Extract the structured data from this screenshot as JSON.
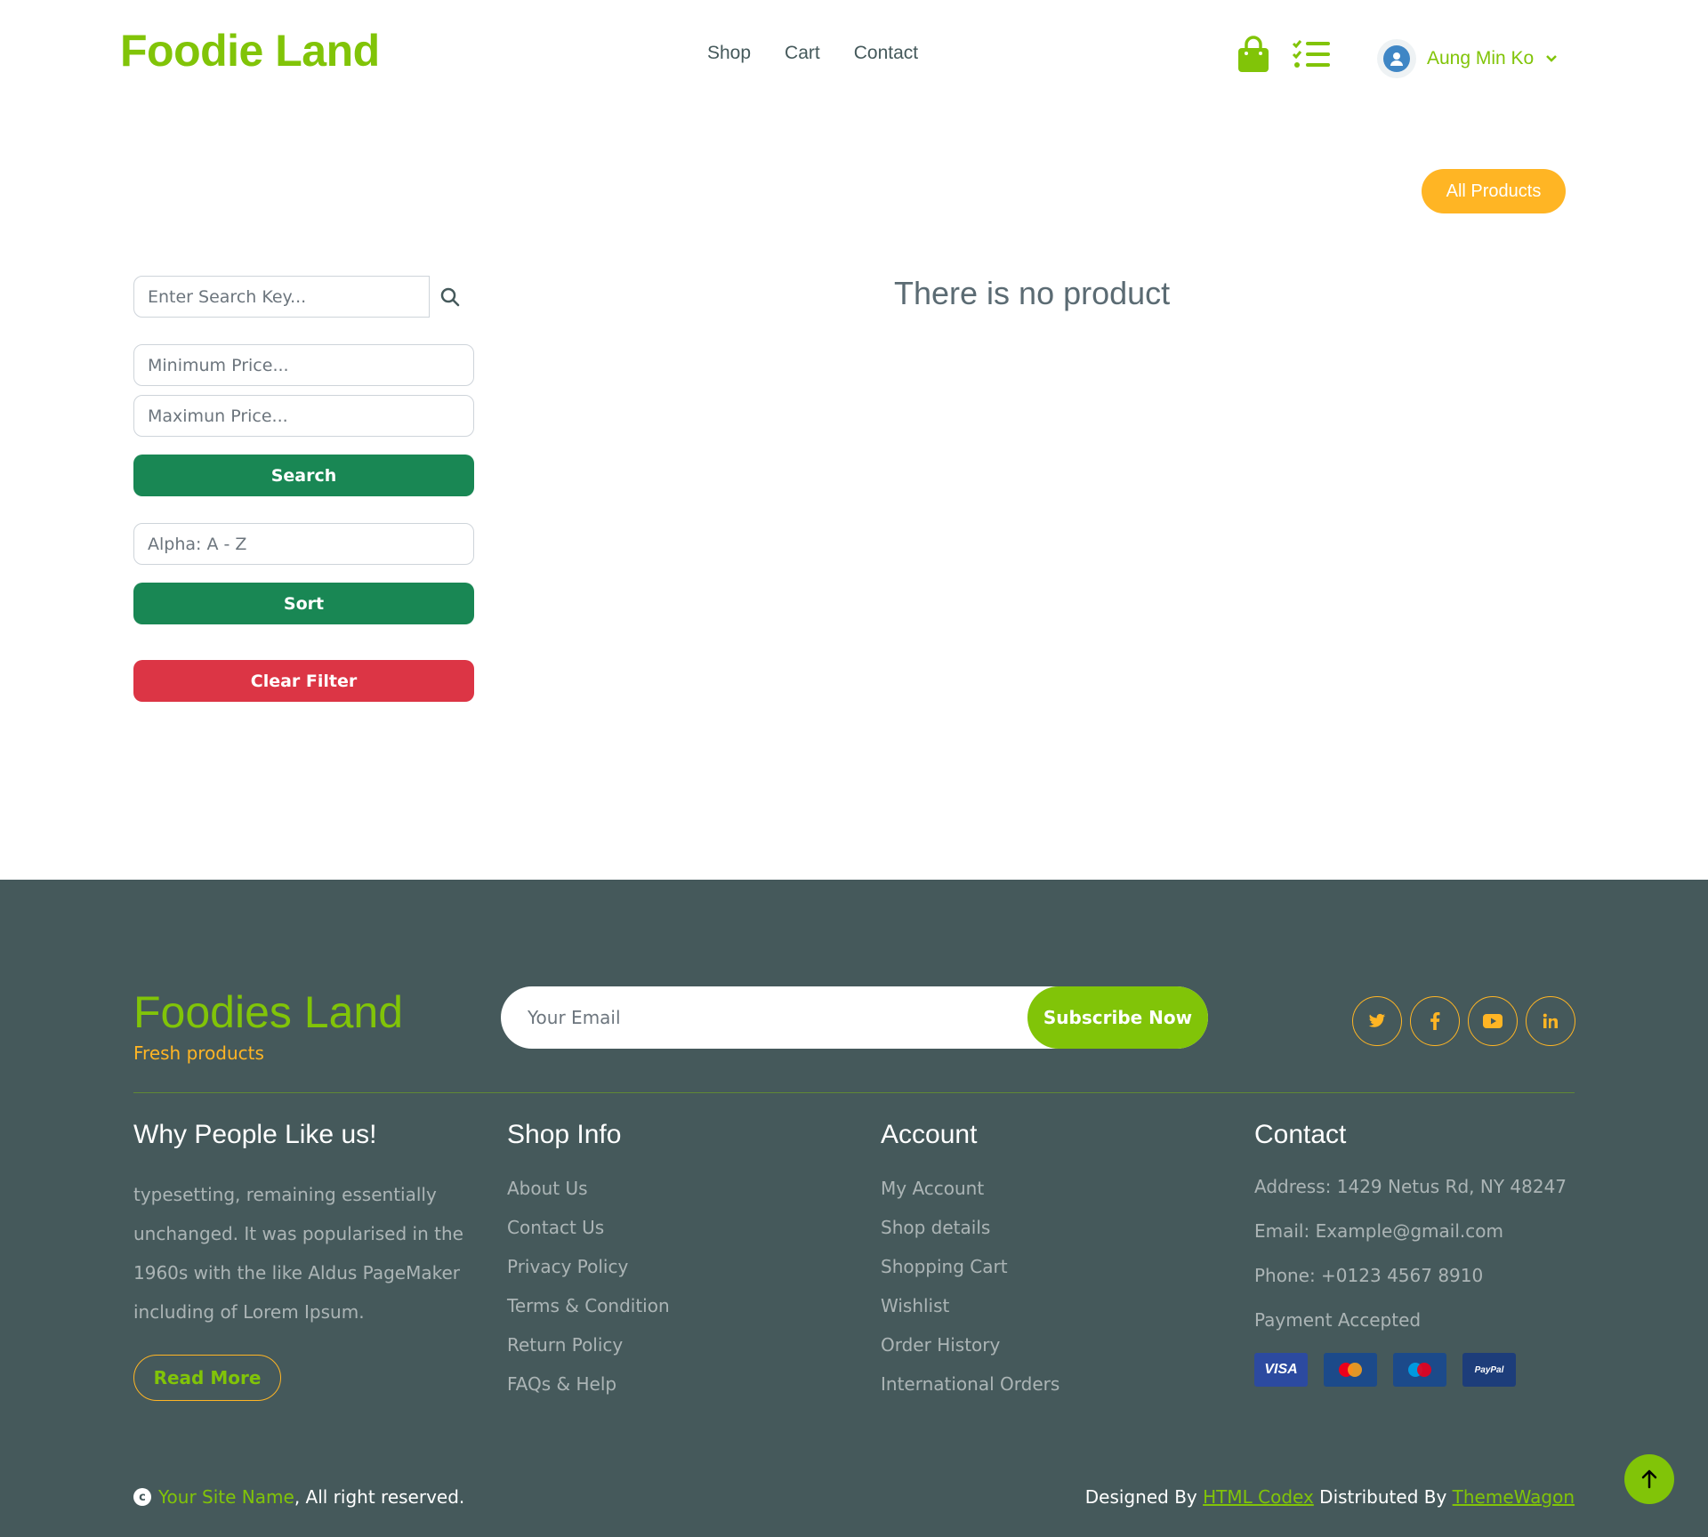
{
  "header": {
    "brand": "Foodie Land",
    "nav": [
      "Shop",
      "Cart",
      "Contact"
    ],
    "user_name": "Aung Min Ko",
    "icons": [
      "shopping-bag-icon",
      "checklist-icon",
      "user-icon",
      "chevron-down-icon"
    ]
  },
  "main": {
    "all_products_label": "All Products",
    "empty_message": "There is no product"
  },
  "filters": {
    "search_placeholder": "Enter Search Key...",
    "min_price_placeholder": "Minimum Price...",
    "max_price_placeholder": "Maximun Price...",
    "search_button": "Search",
    "sort_value": "Alpha: A - Z",
    "sort_button": "Sort",
    "clear_button": "Clear Filter"
  },
  "footer": {
    "brand": "Foodies Land",
    "tagline": "Fresh products",
    "email_placeholder": "Your Email",
    "subscribe_button": "Subscribe Now",
    "socials": [
      "twitter-icon",
      "facebook-icon",
      "youtube-icon",
      "linkedin-icon"
    ],
    "why": {
      "heading": "Why People Like us!",
      "text": "typesetting, remaining essentially unchanged. It was popularised in the 1960s with the like Aldus PageMaker including of Lorem Ipsum.",
      "read_more": "Read More"
    },
    "shop_info": {
      "heading": "Shop Info",
      "links": [
        "About Us",
        "Contact Us",
        "Privacy Policy",
        "Terms & Condition",
        "Return Policy",
        "FAQs & Help"
      ]
    },
    "account": {
      "heading": "Account",
      "links": [
        "My Account",
        "Shop details",
        "Shopping Cart",
        "Wishlist",
        "Order History",
        "International Orders"
      ]
    },
    "contact": {
      "heading": "Contact",
      "address": "Address: 1429 Netus Rd, NY 48247",
      "email": "Email: Example@gmail.com",
      "phone": "Phone: +0123 4567 8910",
      "payment_label": "Payment Accepted",
      "cards": [
        "VISA",
        "MasterCard",
        "Maestro",
        "PayPal"
      ]
    },
    "copyright_site": "Your Site Name",
    "copyright_rest": ", All right reserved.",
    "designed_by_label": "Designed By",
    "designer": "HTML Codex",
    "distributed_by_label": "Distributed By",
    "distributor": "ThemeWagon"
  },
  "colors": {
    "brand_green": "#81c408",
    "accent_yellow": "#ffb524",
    "button_green": "#198754",
    "button_red": "#dc3545",
    "footer_bg": "#45595b"
  }
}
